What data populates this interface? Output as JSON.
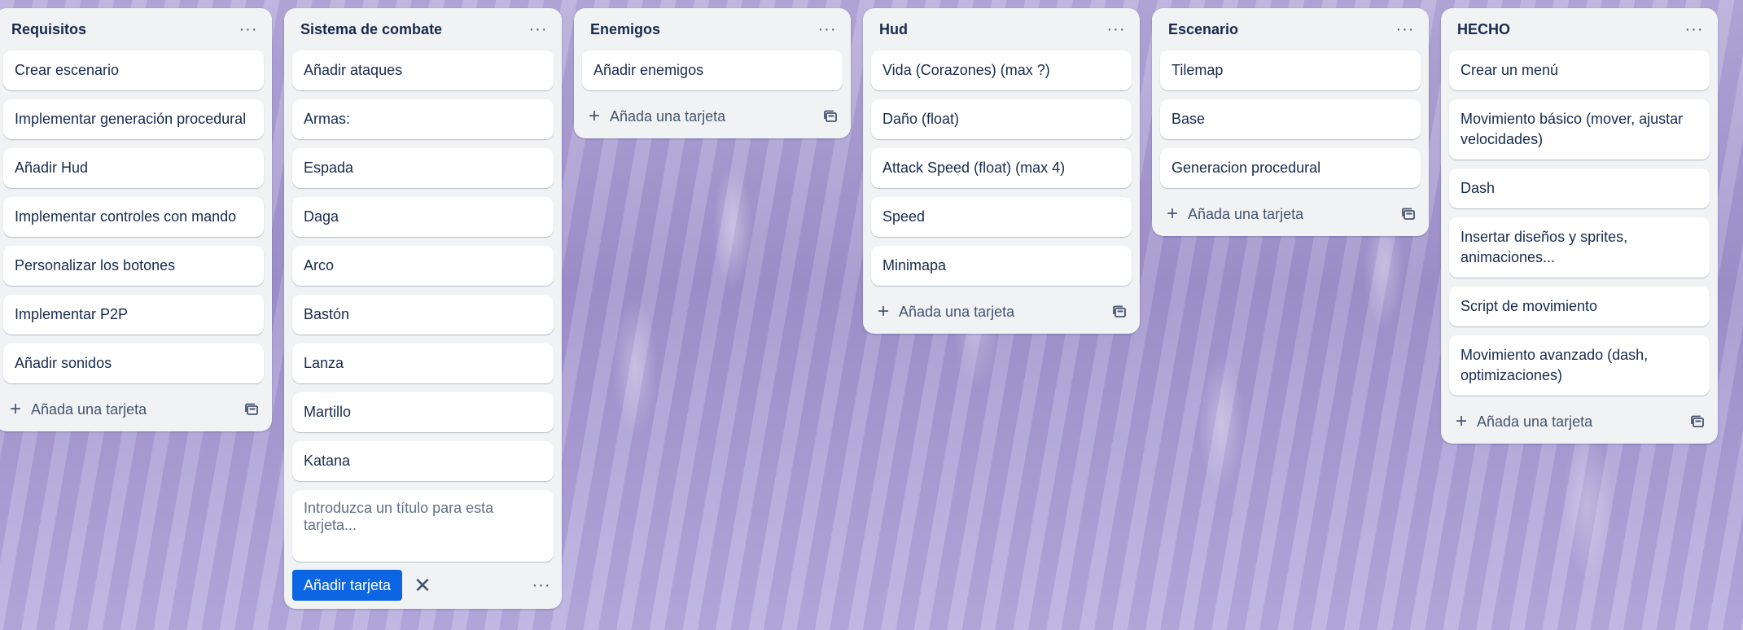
{
  "lists": [
    {
      "title": "Requisitos",
      "cards": [
        "Crear escenario",
        "Implementar generación procedural",
        "Añadir Hud",
        "Implementar controles con mando",
        "Personalizar los botones",
        "Implementar P2P",
        "Añadir sonidos"
      ],
      "add_label": "Añada una tarjeta"
    },
    {
      "title": "Sistema de combate",
      "cards": [
        "Añadir ataques",
        "Armas:",
        "Espada",
        "Daga",
        "Arco",
        "Bastón",
        "Lanza",
        "Martillo",
        "Katana"
      ],
      "composer": {
        "placeholder": "Introduzca un título para esta tarjeta...",
        "submit_label": "Añadir tarjeta"
      }
    },
    {
      "title": "Enemigos",
      "cards": [
        "Añadir enemigos"
      ],
      "add_label": "Añada una tarjeta"
    },
    {
      "title": "Hud",
      "cards": [
        "Vida (Corazones) (max ?)",
        "Daño (float)",
        "Attack Speed (float) (max 4)",
        "Speed",
        "Minimapa"
      ],
      "add_label": "Añada una tarjeta"
    },
    {
      "title": "Escenario",
      "cards": [
        "Tilemap",
        "Base",
        "Generacion procedural"
      ],
      "add_label": "Añada una tarjeta"
    },
    {
      "title": "HECHO",
      "cards": [
        "Crear un menú",
        "Movimiento básico (mover, ajustar velocidades)",
        "Dash",
        "Insertar diseños y sprites, animaciones...",
        "Script de movimiento",
        "Movimiento avanzado (dash, optimizaciones)"
      ],
      "add_label": "Añada una tarjeta"
    }
  ],
  "icons": {
    "more": "more-horizontal-icon",
    "plus": "plus-icon",
    "template": "card-template-icon",
    "close": "close-icon"
  },
  "colors": {
    "list_bg": "#f1f2f4",
    "card_bg": "#ffffff",
    "text": "#172b4d",
    "primary_button": "#0c66e4"
  }
}
